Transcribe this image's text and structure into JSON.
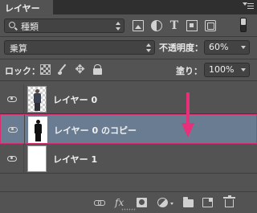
{
  "panel": {
    "tab_label": "レイヤー",
    "close_glyph": "×",
    "menu_icon": "panel-menu-icon"
  },
  "filter": {
    "kind_label": "種類",
    "icons": [
      "image-filter-icon",
      "adjustment-filter-icon",
      "type-filter-icon",
      "shape-filter-icon",
      "smart-object-filter-icon"
    ],
    "type_glyph": "T"
  },
  "blend": {
    "mode": "乗算",
    "opacity_label": "不透明度：",
    "opacity_value": "60%"
  },
  "lock": {
    "label": "ロック：",
    "move_glyph": "✥",
    "fill_label": "塗り：",
    "fill_value": "100%"
  },
  "layers": [
    {
      "name": "レイヤー 0",
      "visible": true,
      "selected": false
    },
    {
      "name": "レイヤー 0 のコピー",
      "visible": true,
      "selected": true
    },
    {
      "name": "レイヤー 1",
      "visible": true,
      "selected": false
    }
  ],
  "annotation": {
    "arrow_color": "#e8307a"
  },
  "toolbar": {
    "fx_label": "fx",
    "icons": [
      "link-layers-icon",
      "fx-icon",
      "add-mask-icon",
      "adjustment-layer-icon",
      "new-group-icon",
      "new-layer-icon",
      "trash-icon"
    ]
  },
  "colors": {
    "panel_bg": "#535353",
    "selected_row": "#6a7c91",
    "selection_border": "#d62f6f"
  }
}
